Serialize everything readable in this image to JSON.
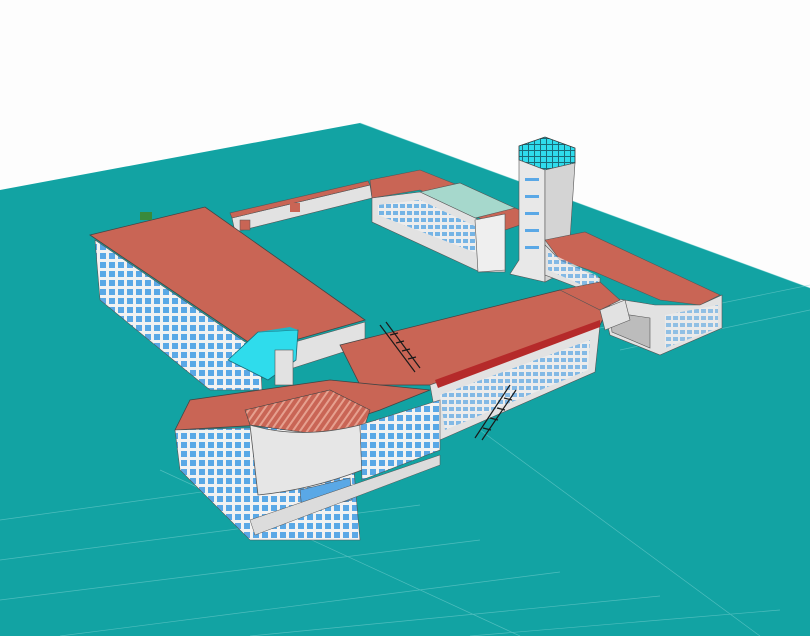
{
  "viewport": {
    "background": "#fdfdfd",
    "ground_color": "#12a3a3",
    "ground_line_color": "#7fd3d3"
  },
  "model": {
    "roof_color": "#c96555",
    "wall_color": "#e2e2e2",
    "window_color": "#5aa8e6",
    "glass_color": "#2fdcec"
  }
}
